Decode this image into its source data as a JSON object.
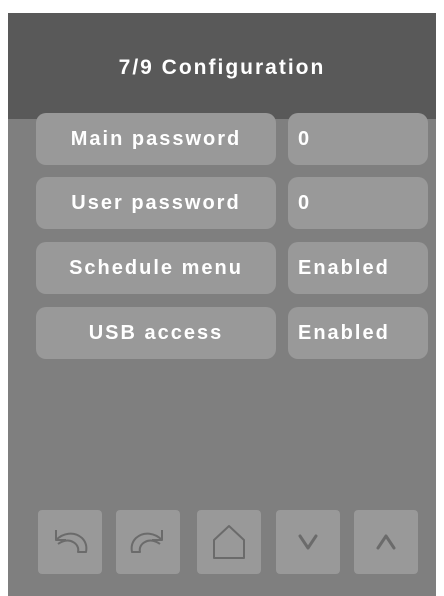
{
  "header": {
    "title": "7/9 Configuration"
  },
  "settings": [
    {
      "label": "Main password",
      "value": "0"
    },
    {
      "label": "User password",
      "value": "0"
    },
    {
      "label": "Schedule menu",
      "value": "Enabled"
    },
    {
      "label": "USB access",
      "value": "Enabled"
    }
  ],
  "navigation": {
    "buttons": [
      {
        "icon": "undo-icon"
      },
      {
        "icon": "redo-icon"
      },
      {
        "icon": "home-icon"
      },
      {
        "icon": "chevron-down-icon"
      },
      {
        "icon": "chevron-up-icon"
      }
    ]
  },
  "colors": {
    "panel_background": "#7f7f7f",
    "header_background": "#595959",
    "button_background": "#999999",
    "text": "#ffffff",
    "icon_stroke": "#6b6b6b"
  }
}
